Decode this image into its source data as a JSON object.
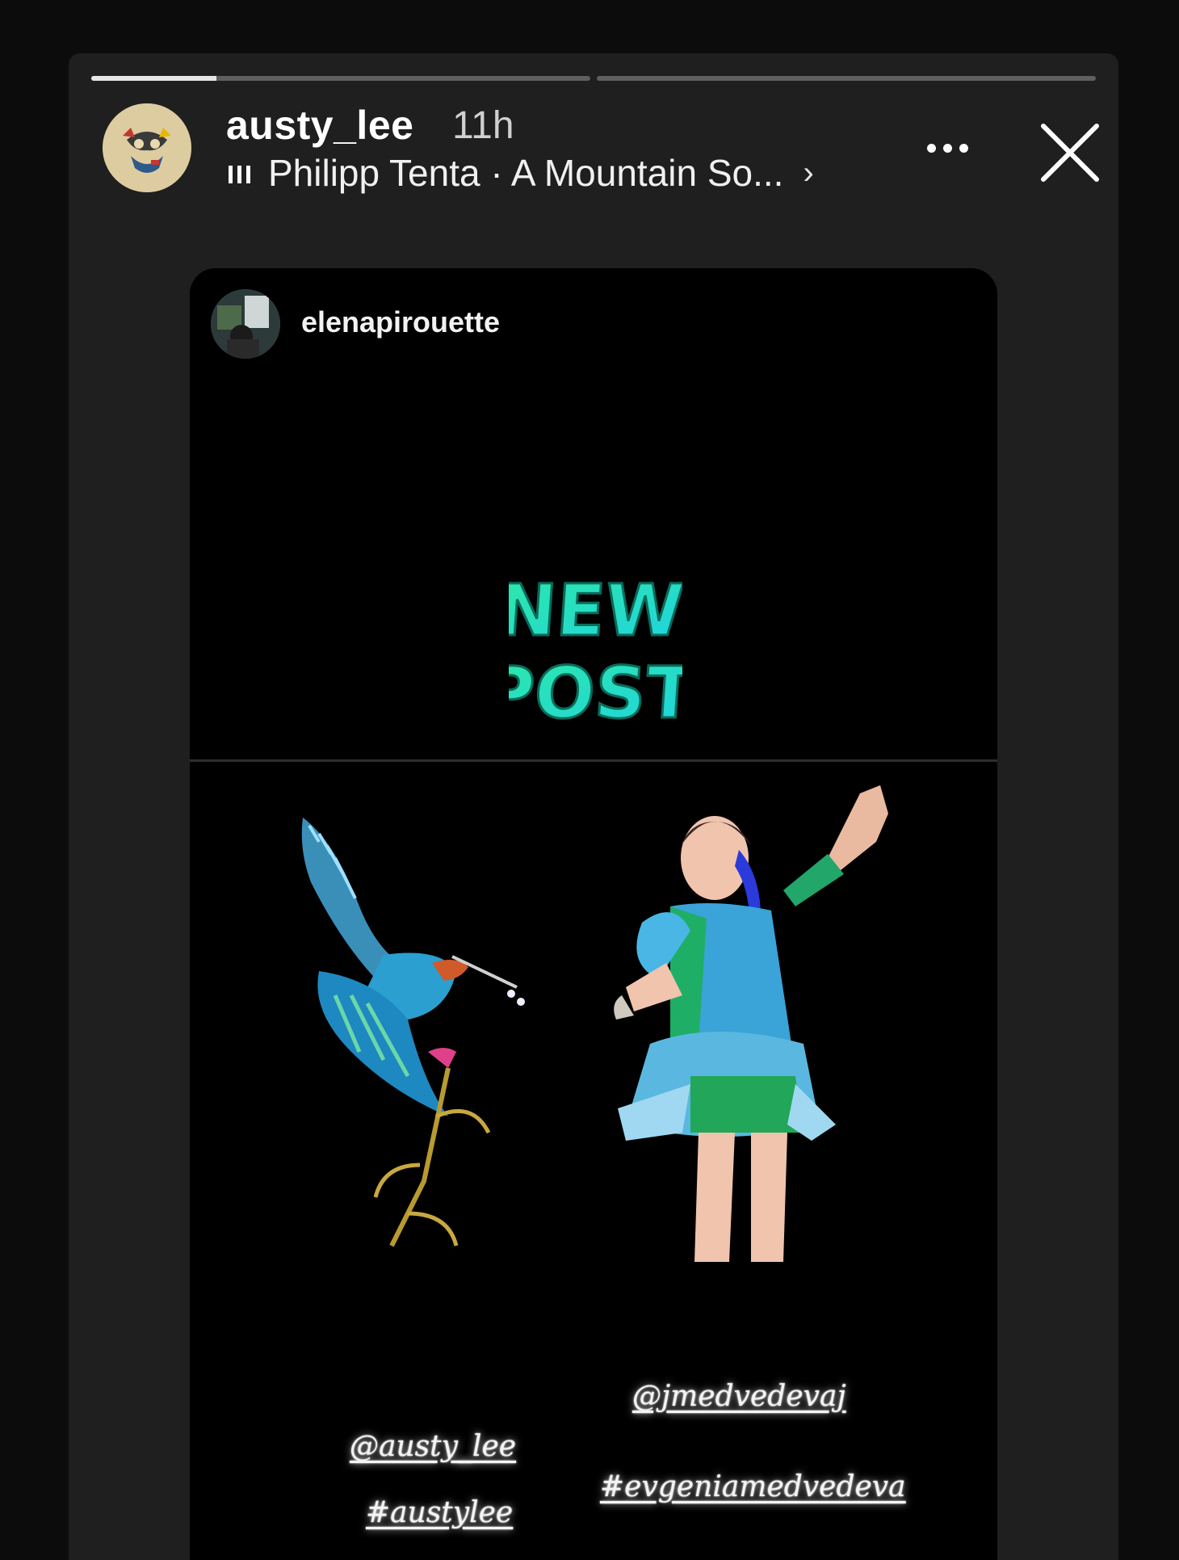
{
  "story": {
    "progress": [
      0.25,
      0.0
    ],
    "username": "austy_lee",
    "time": "11h",
    "music": "Philipp Tenta · A Mountain So...",
    "music_chevron": "›",
    "more_icon": "more-horizontal-icon",
    "close_icon": "close-icon"
  },
  "post": {
    "username": "elenapirouette",
    "sticker_text": "NEW POST",
    "tags_left": [
      "@austy_lee",
      "#austylee"
    ],
    "tags_right": [
      "@jmedvedevaj",
      "#evgeniamedvedeva"
    ]
  },
  "colors": {
    "background": "#0c0c0c",
    "story_panel": "#1f1f1f",
    "card": "#000000",
    "sticker": "#3be0b0"
  }
}
